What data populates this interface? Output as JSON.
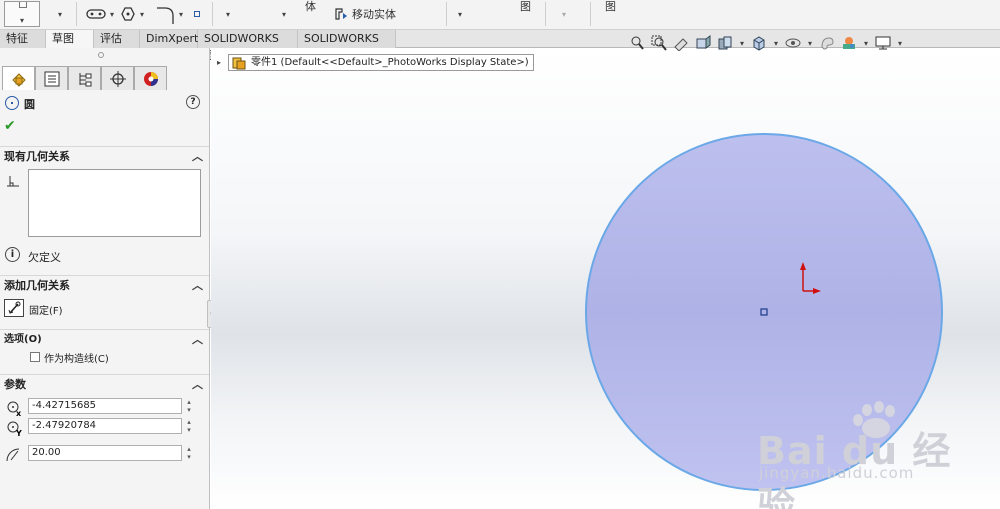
{
  "ribbon": {
    "items": [
      "体",
      "移动实体",
      "图",
      "图"
    ]
  },
  "tabs": [
    {
      "label": "特征",
      "active": false
    },
    {
      "label": "草图",
      "active": true
    },
    {
      "label": "评估",
      "active": false
    },
    {
      "label": "DimXpert",
      "active": false
    },
    {
      "label": "SOLIDWORKS 插件",
      "active": false
    },
    {
      "label": "SOLIDWORKS MBD",
      "active": false
    }
  ],
  "panel": {
    "title": "圆",
    "existing_relations": {
      "header": "现有几何关系",
      "status": "欠定义"
    },
    "add_relations": {
      "header": "添加几何关系",
      "fix_label": "固定(F)"
    },
    "options": {
      "header": "选项(O)",
      "construction_label": "作为构造线(C)"
    },
    "parameters": {
      "header": "参数",
      "center_x": "-4.42715685",
      "center_y": "-2.47920784",
      "radius": "20.00"
    }
  },
  "tree": {
    "label": "零件1  (Default<<Default>_PhotoWorks Display State>)"
  },
  "watermark": {
    "brand": "Bai du 经验",
    "url": "jingyan.baidu.com"
  },
  "colors": {
    "circle_fill": "#b4b8ea",
    "circle_stroke": "#6aa8e8",
    "origin_red": "#d01010",
    "accent_green": "#2a9a2a"
  }
}
